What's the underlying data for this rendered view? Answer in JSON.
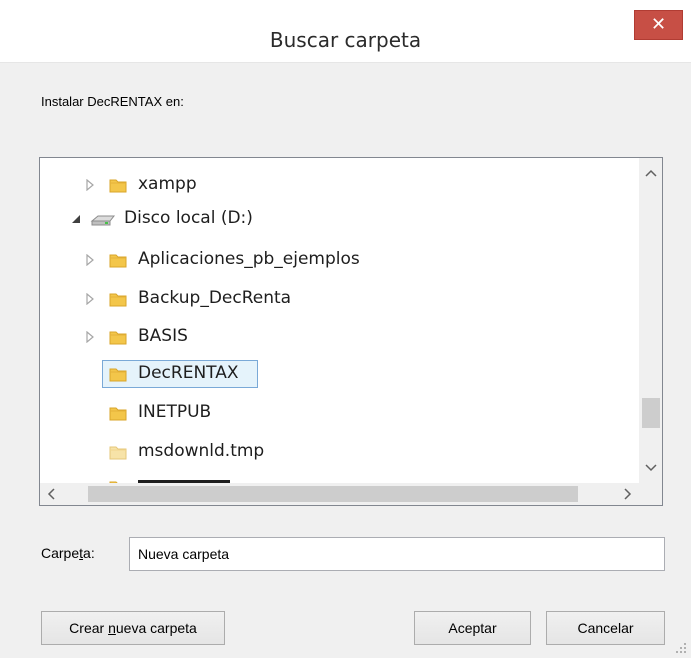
{
  "window": {
    "title": "Buscar carpeta",
    "close_symbol": "✕"
  },
  "instruction": "Instalar DecRENTAX en:",
  "tree": {
    "items": [
      {
        "label": "xampp",
        "icon": "folder-icon",
        "expander": "collapsed"
      },
      {
        "label": "Disco local (D:)",
        "icon": "drive-icon",
        "expander": "expanded"
      },
      {
        "label": "Aplicaciones_pb_ejemplos",
        "icon": "folder-icon",
        "expander": "collapsed"
      },
      {
        "label": "Backup_DecRenta",
        "icon": "folder-icon",
        "expander": "collapsed"
      },
      {
        "label": "BASIS",
        "icon": "folder-icon",
        "expander": "collapsed"
      },
      {
        "label": "DecRENTAX",
        "icon": "folder-icon",
        "expander": "none",
        "selected": true
      },
      {
        "label": "INETPUB",
        "icon": "folder-icon",
        "expander": "none"
      },
      {
        "label": "msdownld.tmp",
        "icon": "folder-icon",
        "expander": "none",
        "hidden_style": true
      }
    ]
  },
  "folder_field": {
    "label_prefix": "Carpe",
    "label_accesskey": "t",
    "label_suffix": "a:",
    "value": "Nueva carpeta"
  },
  "buttons": {
    "new_folder_prefix": "Crear ",
    "new_folder_accesskey": "n",
    "new_folder_suffix": "ueva carpeta",
    "ok": "Aceptar",
    "cancel": "Cancelar"
  },
  "colors": {
    "close_button": "#c74f45",
    "selection_border": "#7aa9d7",
    "selection_fill": "#e5f3fb",
    "folder_yellow": "#f3c64a"
  }
}
